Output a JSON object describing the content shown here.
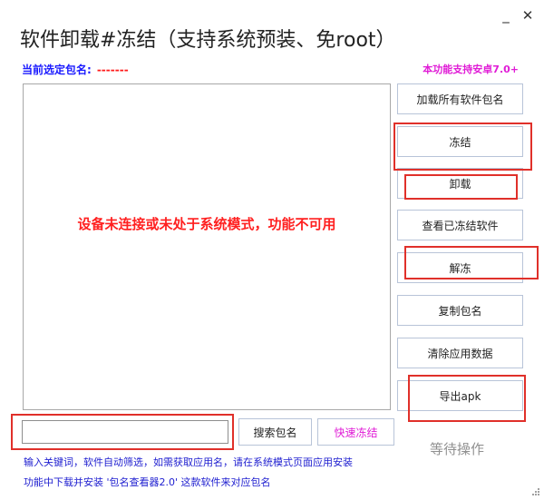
{
  "window": {
    "title": "软件卸载#冻结（支持系统预装、免root）",
    "minimize_glyph": "_",
    "close_glyph": "✕"
  },
  "header": {
    "current_label": "当前选定包名:",
    "current_value": "-------",
    "support_note": "本功能支持安卓7.0+"
  },
  "list": {
    "warning": "设备未连接或未处于系统模式，功能不可用"
  },
  "sidebar": {
    "load_all": "加载所有软件包名",
    "freeze": "冻结",
    "uninstall": "卸载",
    "view_frozen": "查看已冻结软件",
    "unfreeze": "解冻",
    "copy_package": "复制包名",
    "clear_data": "清除应用数据",
    "export_apk": "导出apk"
  },
  "search": {
    "input_value": "",
    "search_button": "搜索包名",
    "quick_freeze": "快速冻结"
  },
  "hints": {
    "line1": "输入关键词，软件自动筛选，如需获取应用名，请在系统模式页面应用安装",
    "line2": "功能中下载并安装 '包名查看器2.0' 这款软件来对应包名"
  },
  "status": {
    "text": "等待操作"
  },
  "colors": {
    "blue_text": "#1a1aff",
    "red_text": "#ff1a1a",
    "magenta_text": "#e01cd6",
    "highlight_box": "#e0302a"
  }
}
